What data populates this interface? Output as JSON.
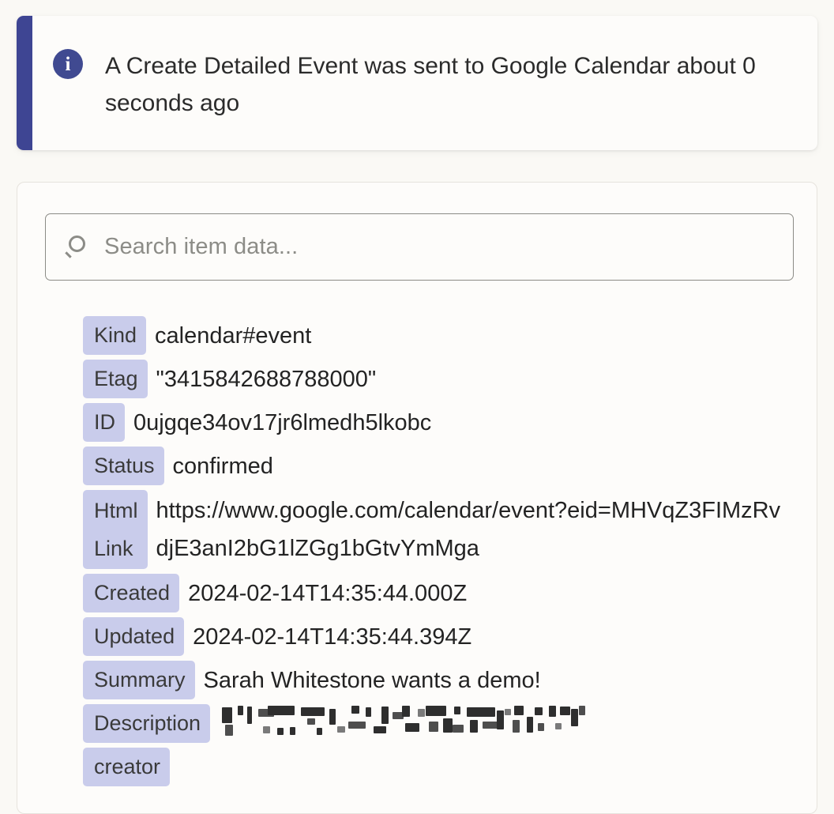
{
  "alert": {
    "icon": "info-icon",
    "message": "A Create Detailed Event was sent to Google Calendar about 0 seconds ago",
    "accent_color": "#3e4593",
    "icon_glyph": "i"
  },
  "search": {
    "icon": "search-icon",
    "value": "",
    "placeholder": "Search item data..."
  },
  "item_data": {
    "rows": [
      {
        "key": "Kind",
        "value": "calendar#event"
      },
      {
        "key": "Etag",
        "value": "\"3415842688788000\""
      },
      {
        "key": "ID",
        "value": "0ujgqe34ov17jr6lmedh5lkobc"
      },
      {
        "key": "Status",
        "value": "confirmed"
      },
      {
        "key": "Html\nLink",
        "value": "https://www.google.com/calendar/event?eid=MHVqZ3FIMzRvdjE3anI2bG1lZGg1bGtvYmMga"
      },
      {
        "key": "Created",
        "value": "2024-02-14T14:35:44.000Z"
      },
      {
        "key": "Updated",
        "value": "2024-02-14T14:35:44.394Z"
      },
      {
        "key": "Summary",
        "value": "Sarah Whitestone wants a demo!"
      },
      {
        "key": "Description",
        "value": "",
        "redacted": true
      },
      {
        "key": "creator",
        "value": ""
      }
    ],
    "chip_color": "#c9cceb"
  }
}
